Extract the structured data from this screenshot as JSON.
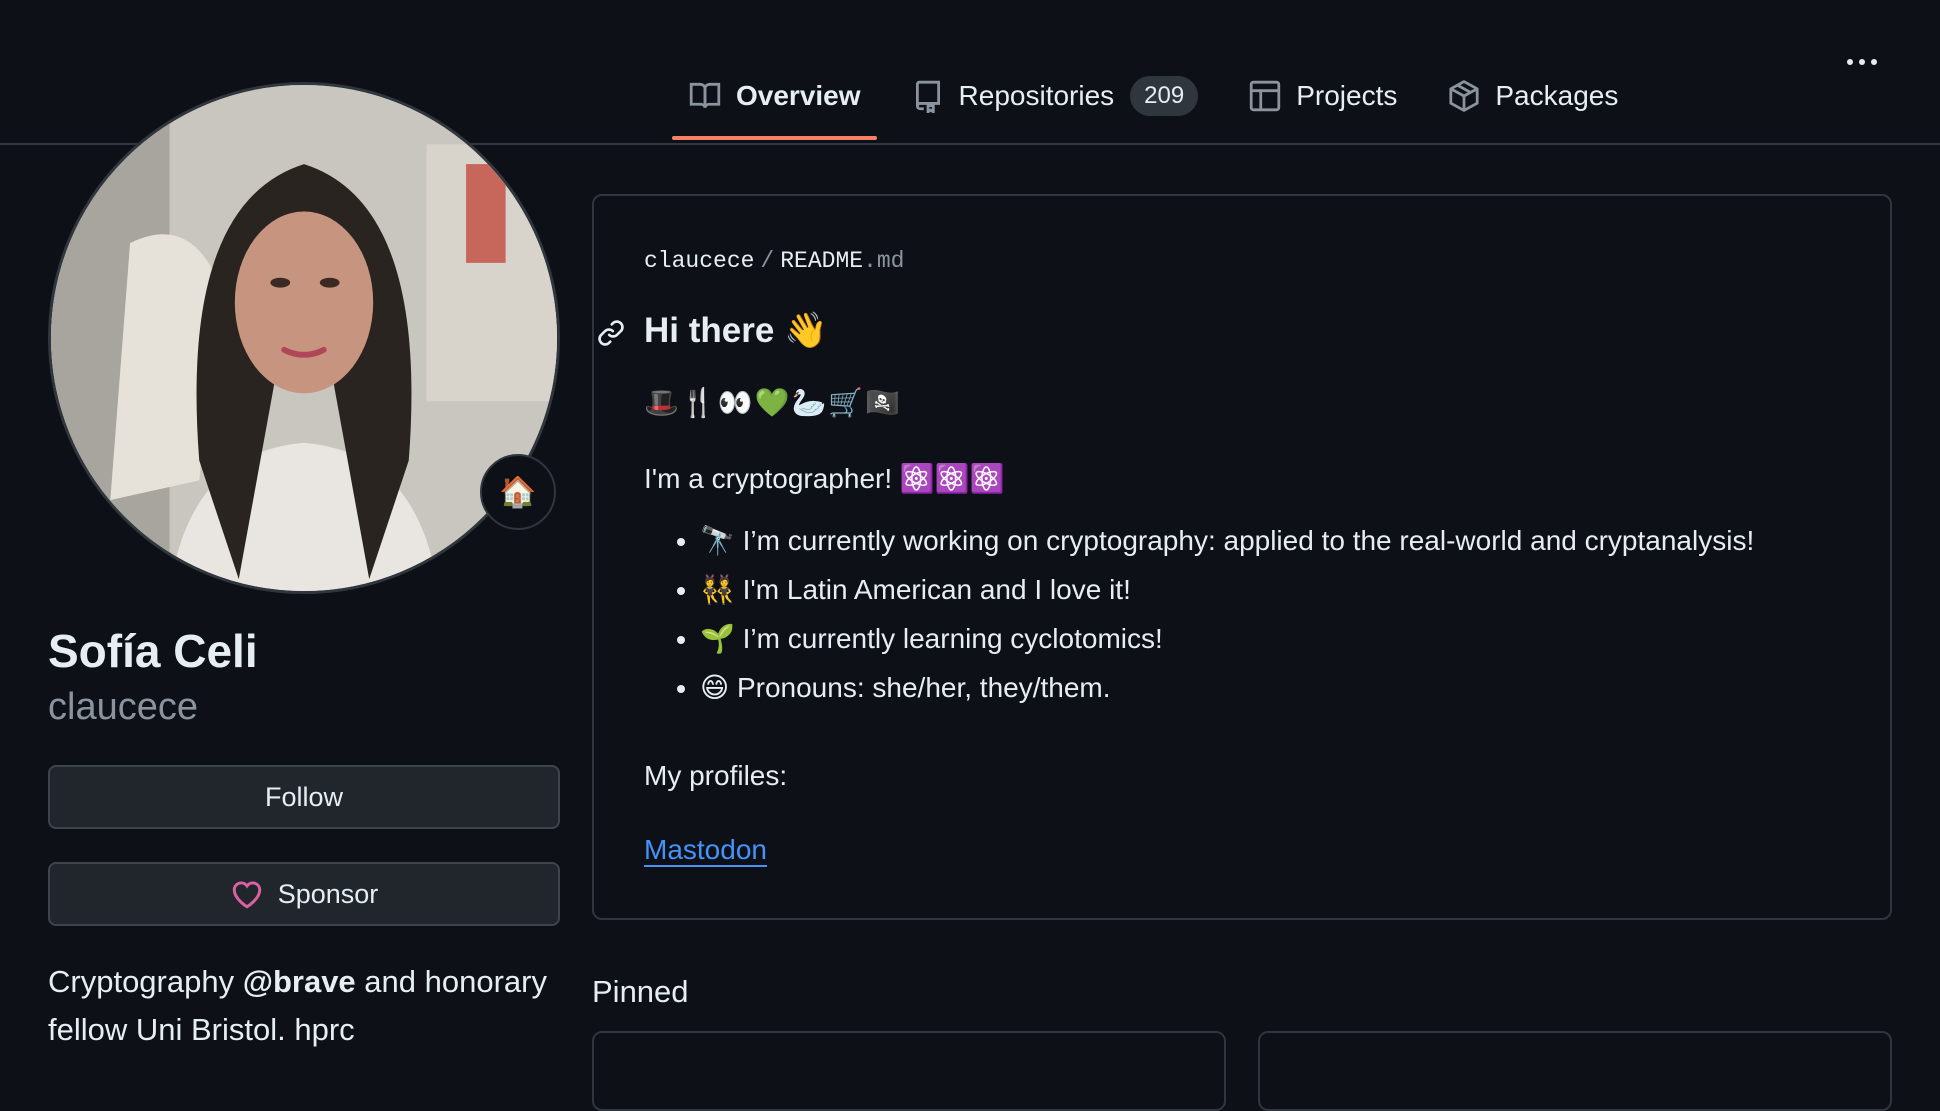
{
  "nav": {
    "tabs": [
      {
        "label": "Overview",
        "icon": "book-icon",
        "active": true
      },
      {
        "label": "Repositories",
        "icon": "repo-icon",
        "count": "209"
      },
      {
        "label": "Projects",
        "icon": "table-icon"
      },
      {
        "label": "Packages",
        "icon": "package-icon"
      }
    ]
  },
  "profile": {
    "full_name": "Sofía Celi",
    "username": "claucece",
    "status_emoji": "🏠",
    "follow_label": "Follow",
    "sponsor_label": "Sponsor",
    "bio_part1": "Cryptography ",
    "bio_mention": "@brave",
    "bio_part2": " and honorary fellow Uni Bristol. hprc"
  },
  "readme": {
    "owner": "claucece",
    "separator": "/",
    "file_name": "README",
    "file_ext": ".md",
    "heading": "Hi there 👋",
    "emoji_line": "🎩🍴👀💚🦢🛒🏴‍☠️",
    "crypto_line": "I'm a cryptographer! ⚛️⚛️⚛️",
    "list_items": [
      "🔭 I’m currently working on cryptography: applied to the real-world and cryptanalysis!",
      "👯 I'm Latin American and I love it!",
      "🌱 I’m currently learning cyclotomics!",
      "😄 Pronouns: she/her, they/them."
    ],
    "profiles_label": "My profiles:",
    "link_label": "Mastodon"
  },
  "pinned": {
    "title": "Pinned"
  },
  "colors": {
    "background": "#0d1117",
    "border": "#30363d",
    "accent_tab": "#f78166",
    "link": "#4493f8",
    "sponsor_heart": "#db61a2"
  }
}
